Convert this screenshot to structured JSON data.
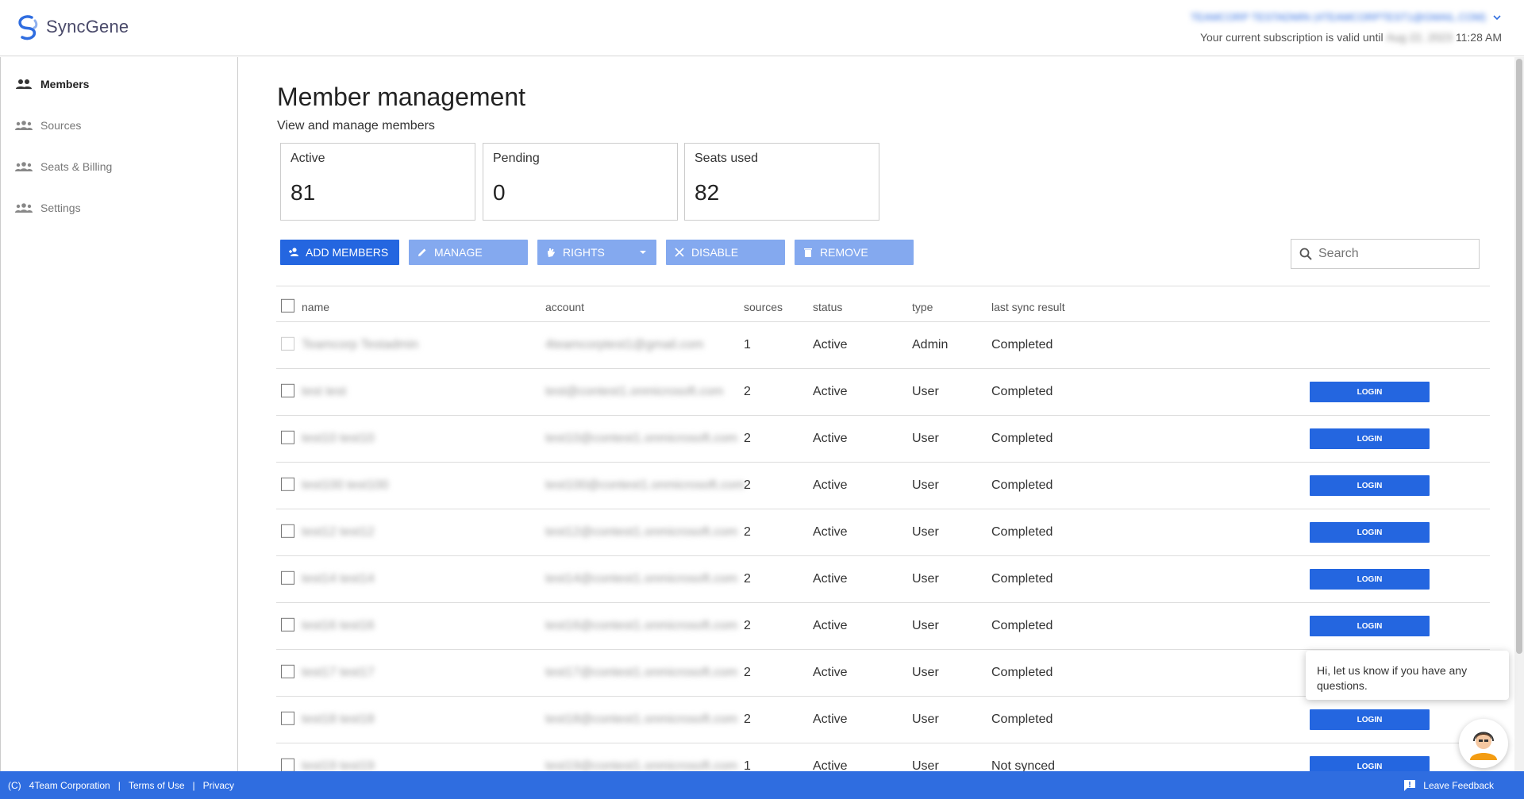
{
  "header": {
    "brand": "SyncGene",
    "account_email": "TEAMCORP TESTADMIN (4TEAMCORPTEST1@GMAIL.COM)",
    "subscription_prefix": "Your current subscription is valid until",
    "subscription_date": "Aug 22, 2023",
    "subscription_time": "11:28 AM"
  },
  "sidebar": {
    "items": [
      {
        "label": "Members",
        "icon": "members-icon",
        "active": true
      },
      {
        "label": "Sources",
        "icon": "group-icon",
        "active": false
      },
      {
        "label": "Seats & Billing",
        "icon": "group-icon",
        "active": false
      },
      {
        "label": "Settings",
        "icon": "group-icon",
        "active": false
      }
    ]
  },
  "main": {
    "title": "Member management",
    "subtitle": "View and manage members",
    "cards": [
      {
        "label": "Active",
        "value": "81"
      },
      {
        "label": "Pending",
        "value": "0"
      },
      {
        "label": "Seats used",
        "value": "82"
      }
    ],
    "toolbar": {
      "add_members": "ADD MEMBERS",
      "manage": "MANAGE",
      "rights": "RIGHTS",
      "disable": "DISABLE",
      "remove": "REMOVE"
    },
    "search": {
      "placeholder": "Search"
    },
    "table": {
      "headers": {
        "name": "name",
        "account": "account",
        "sources": "sources",
        "status": "status",
        "type": "type",
        "sync": "last sync result"
      },
      "login_label": "LOGIN",
      "rows": [
        {
          "name": "Teamcorp Testadmin",
          "account": "4teamcorptest1@gmail.com",
          "sources": "1",
          "status": "Active",
          "type": "Admin",
          "sync": "Completed"
        },
        {
          "name": "test test",
          "account": "test@contest1.onmicrosoft.com",
          "sources": "2",
          "status": "Active",
          "type": "User",
          "sync": "Completed"
        },
        {
          "name": "test10 test10",
          "account": "test10@contest1.onmicrosoft.com",
          "sources": "2",
          "status": "Active",
          "type": "User",
          "sync": "Completed"
        },
        {
          "name": "test100 test100",
          "account": "test100@contest1.onmicrosoft.com",
          "sources": "2",
          "status": "Active",
          "type": "User",
          "sync": "Completed"
        },
        {
          "name": "test12 test12",
          "account": "test12@contest1.onmicrosoft.com",
          "sources": "2",
          "status": "Active",
          "type": "User",
          "sync": "Completed"
        },
        {
          "name": "test14 test14",
          "account": "test14@contest1.onmicrosoft.com",
          "sources": "2",
          "status": "Active",
          "type": "User",
          "sync": "Completed"
        },
        {
          "name": "test16 test16",
          "account": "test16@contest1.onmicrosoft.com",
          "sources": "2",
          "status": "Active",
          "type": "User",
          "sync": "Completed"
        },
        {
          "name": "test17 test17",
          "account": "test17@contest1.onmicrosoft.com",
          "sources": "2",
          "status": "Active",
          "type": "User",
          "sync": "Completed"
        },
        {
          "name": "test18 test18",
          "account": "test18@contest1.onmicrosoft.com",
          "sources": "2",
          "status": "Active",
          "type": "User",
          "sync": "Completed"
        },
        {
          "name": "test19 test19",
          "account": "test19@contest1.onmicrosoft.com",
          "sources": "1",
          "status": "Active",
          "type": "User",
          "sync": "Not synced"
        }
      ]
    }
  },
  "chat": {
    "message": "Hi, let us know if you have any questions."
  },
  "footer": {
    "copyright": "(C)",
    "company": "4Team Corporation",
    "terms": "Terms of Use",
    "privacy": "Privacy",
    "separator": "|",
    "feedback": "Leave Feedback"
  },
  "colors": {
    "accent": "#2466e0",
    "accent_light": "#84a9ef",
    "footer": "#2f6de0"
  }
}
